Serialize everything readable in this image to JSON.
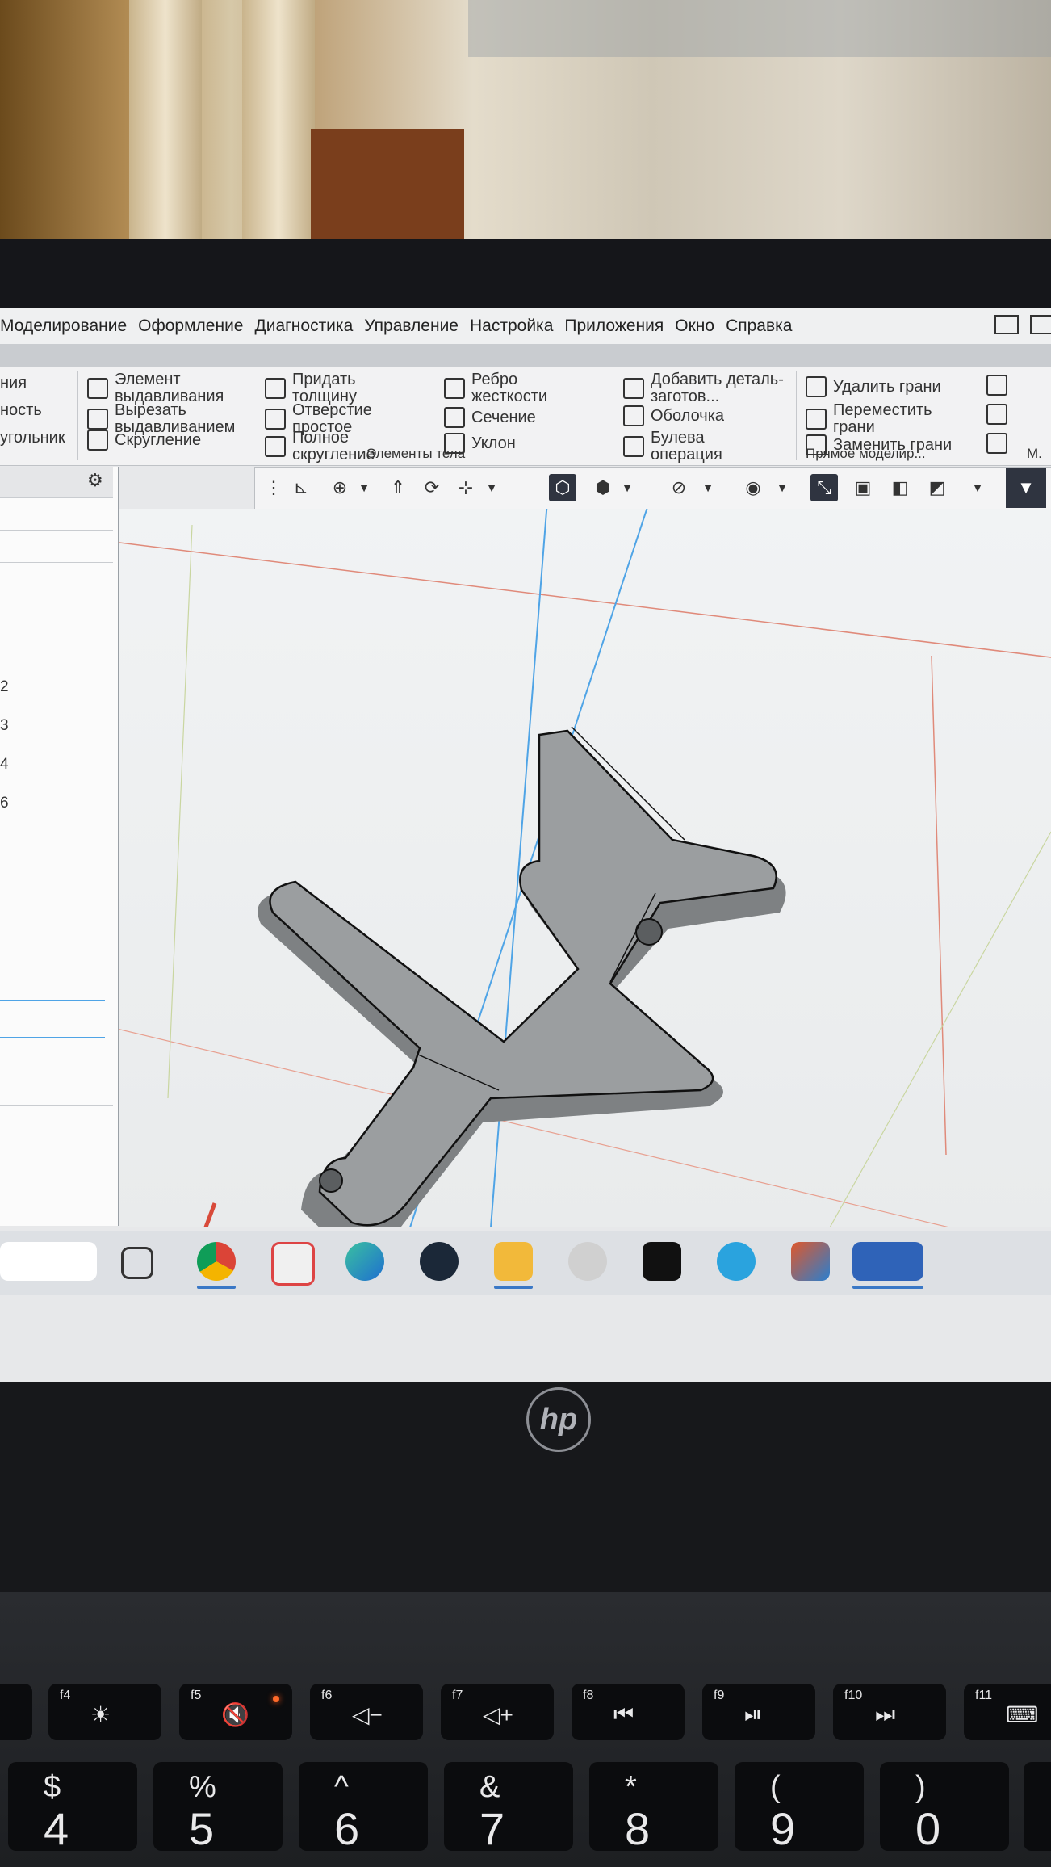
{
  "menu": {
    "items": [
      "Моделирование",
      "Оформление",
      "Диагностика",
      "Управление",
      "Настройка",
      "Приложения",
      "Окно",
      "Справка"
    ]
  },
  "ribbon": {
    "left_partial": [
      "ния",
      "ность",
      "угольник"
    ],
    "col1": [
      "Элемент выдавливания",
      "Вырезать выдавливанием",
      "Скругление"
    ],
    "col2": [
      "Придать толщину",
      "Отверстие простое",
      "Полное скругление"
    ],
    "col3": [
      "Ребро жесткости",
      "Сечение",
      "Уклон"
    ],
    "col4": [
      "Добавить деталь-заготов...",
      "Оболочка",
      "Булева операция"
    ],
    "col5": [
      "Удалить грани",
      "Переместить грани",
      "Заменить грани"
    ],
    "group_body": "Элементы тела",
    "group_direct": "Прямое моделир...",
    "group_m": "М."
  },
  "tree": {
    "numbers": [
      "2",
      "3",
      "4",
      "6"
    ]
  },
  "taskbar": {
    "apps": [
      "copilot",
      "task-view",
      "chrome",
      "store",
      "edge",
      "steam",
      "file-explorer",
      "paint",
      "capcut",
      "telegram",
      "matlab",
      "kompas-3d"
    ]
  },
  "laptop": {
    "brand": "hp",
    "fn_keys": [
      {
        "label": "f4",
        "icon": "☀"
      },
      {
        "label": "f5",
        "icon": "🔇"
      },
      {
        "label": "f6",
        "icon": "◁−"
      },
      {
        "label": "f7",
        "icon": "◁+"
      },
      {
        "label": "f8",
        "icon": "⏮"
      },
      {
        "label": "f9",
        "icon": "⏯"
      },
      {
        "label": "f10",
        "icon": "⏭"
      },
      {
        "label": "f11",
        "icon": "⌨"
      }
    ],
    "num_keys": [
      {
        "top": "$",
        "bottom": "4"
      },
      {
        "top": "%",
        "bottom": "5"
      },
      {
        "top": "^",
        "bottom": "6"
      },
      {
        "top": "&",
        "bottom": "7"
      },
      {
        "top": "*",
        "bottom": "8"
      },
      {
        "top": "(",
        "bottom": "9"
      },
      {
        "top": ")",
        "bottom": "0"
      }
    ]
  },
  "colors": {
    "model_face": "#8f9294",
    "model_edge": "#111111",
    "axis_x": "#3b8ed8",
    "axis_y": "#d84a3a",
    "axis_z": "#4aa04a",
    "plane_line_blue": "#4fa4e6",
    "plane_line_red": "#e08a7a",
    "selection_dark": "#2f3440"
  }
}
